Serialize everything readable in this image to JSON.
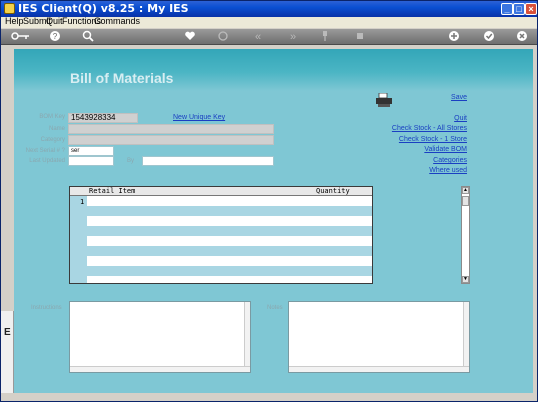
{
  "window": {
    "title": "IES Client(Q) v8.25 : My IES",
    "minimize": "_",
    "maximize": "□",
    "close": "×"
  },
  "menu": [
    "Help",
    "Submit",
    "Quit",
    "Functions",
    "Commands"
  ],
  "toolbar": {
    "icons": [
      "key-icon",
      "help-icon",
      "search-icon",
      "heart-icon",
      "refresh-icon",
      "rewind-icon",
      "forward-icon",
      "pin-icon",
      "stop-icon",
      "add-icon",
      "check-icon",
      "close-icon"
    ]
  },
  "page": {
    "title": "Bill of Materials"
  },
  "form": {
    "bom_key_label": "BOM Key",
    "bom_key_value": "1543928334",
    "new_unique_key": "New Unique Key",
    "name_label": "Name",
    "category_label": "Category",
    "next_serial_label": "Next Serial # ?",
    "next_serial_value": "ser",
    "last_updated_label": "Last Updated",
    "by_label": "By"
  },
  "actions": {
    "save": "Save",
    "quit": "Quit",
    "check_stock_all": "Check Stock - All Stores",
    "check_stock_one": "Check Stock - 1 Store",
    "validate_bom": "Validate BOM",
    "categories": "Categories",
    "where_used": "Where used"
  },
  "grid": {
    "columns": [
      "Retail Item",
      "Quantity"
    ],
    "first_row_number": "1"
  },
  "memo": {
    "instructions_label": "Instructions",
    "notes_label": "Notes"
  },
  "colors": {
    "background": "#7fc7d4",
    "header_band": "#33a6b8",
    "link": "#1a3fc2"
  }
}
